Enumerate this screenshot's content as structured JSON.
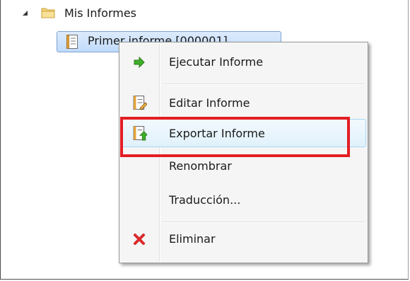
{
  "tree": {
    "folder_label": "Mis Informes",
    "report_label": "Primer informe [000001]",
    "icons": {
      "expander": "expanded-triangle-icon",
      "folder": "folder-icon",
      "report": "report-icon"
    }
  },
  "context_menu": {
    "items": [
      {
        "label": "Ejecutar Informe",
        "icon": "run-arrow-icon"
      },
      {
        "label": "Editar Informe",
        "icon": "edit-report-icon"
      },
      {
        "label": "Exportar Informe",
        "icon": "export-report-icon"
      },
      {
        "label": "Renombrar",
        "icon": ""
      },
      {
        "label": "Traducción...",
        "icon": ""
      },
      {
        "label": "Eliminar",
        "icon": "delete-x-icon"
      }
    ],
    "highlighted_item": "Exportar Informe"
  },
  "colors": {
    "highlight_border": "#e31e24",
    "run_arrow": "#3fae2a",
    "delete_x": "#d92b2b",
    "selection_border": "#7da2ce"
  }
}
